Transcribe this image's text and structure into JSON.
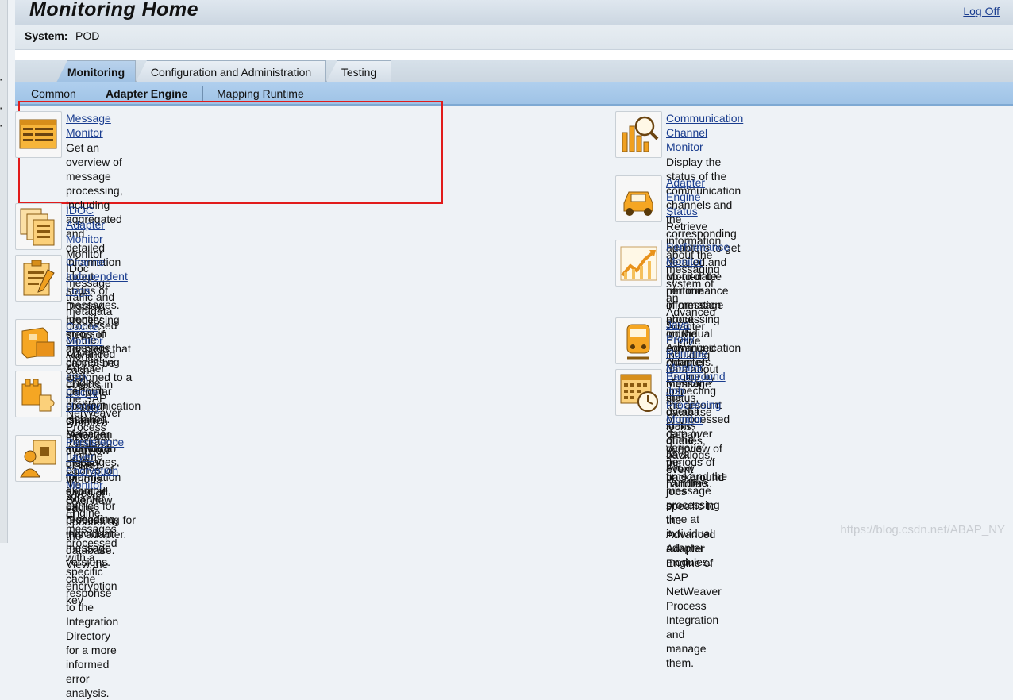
{
  "header": {
    "title": "Monitoring Home",
    "logoff_label": "Log Off"
  },
  "system": {
    "label": "System:",
    "value": "POD"
  },
  "tabs": [
    {
      "label": "Monitoring",
      "active": true
    },
    {
      "label": "Configuration and Administration",
      "active": false
    },
    {
      "label": "Testing",
      "active": false
    }
  ],
  "subnav": [
    {
      "label": "Common",
      "active": false
    },
    {
      "label": "Adapter Engine",
      "active": true
    },
    {
      "label": "Mapping Runtime",
      "active": false
    }
  ],
  "left_items": [
    {
      "title": "Message Monitor",
      "icon": "message-list-icon",
      "lines": [
        "Get an overview of message processing, including aggregated and",
        "detailed information about status of messages. Identify errors in",
        "message processing and perform problem isolation. Manage",
        "individual messages, for example, by resending individual message",
        "versions."
      ]
    },
    {
      "title": "IDOC Adapter Monitor",
      "icon": "idoc-documents-icon",
      "lines": [
        "Monitor IDoc message traffic and metadata processed on the",
        "Advanced Adapter Engine."
      ]
    },
    {
      "title": "Channel-Independent Logs",
      "icon": "clipboard-log-icon",
      "lines": [
        "Display processing steps of adapters that cannot be assigned to a",
        "particular communication channel. Select an adapter to display",
        "information about all entries for processing for this adapter."
      ]
    },
    {
      "title": "Cache Monitor",
      "icon": "cache-boxes-icon",
      "lines": [
        "Monitor cache objects in the SAP NetWeaver Process Integration",
        "runtime caches of the Adapter Engine."
      ]
    },
    {
      "title": "CPA Cache History",
      "icon": "puzzle-history-icon",
      "lines": [
        "Obtain a historical overview of the various types of cache updates to",
        "the database. View the cache response to the Integration Directory",
        "for a more informed error analysis."
      ]
    },
    {
      "title": "Persistence Layer Encryption Monitor",
      "icon": "encryption-user-icon",
      "lines": [
        "Overview of messages processed with a specific encryption key"
      ]
    }
  ],
  "right_items": [
    {
      "title": "Communication Channel Monitor",
      "icon": "channel-chart-magnifier-icon",
      "lines": [
        "Display the status of the communication channels and the",
        "corresponding adapters to get detailed and up-to-date runtime",
        "information about individual communication channels."
      ]
    },
    {
      "title": "Adapter Engine Status",
      "icon": "engine-car-icon",
      "lines": [
        "Retrieve information about the messaging system of an Advanced",
        "Adapter Engine including data about message status, database",
        "locks, queues, backlogs, event handlers."
      ]
    },
    {
      "title": "Performance Monitor",
      "icon": "performance-graph-icon",
      "lines": [
        "Monitor the performance of message processing on the Advanced",
        "Adapter Engine by inspecting the amount of processed data over",
        "various periods of time and the message processing time at",
        "individual adapter modules."
      ]
    },
    {
      "title": "Java Proxy Runtime Monitor",
      "icon": "proxy-train-icon",
      "lines": [
        "Monitor the overall status of the Java Proxy Runtime"
      ]
    },
    {
      "title": "Background Job Processing Monitor",
      "icon": "calendar-clock-icon",
      "lines": [
        "Get an overview of the background jobs specific to the Advanced",
        "Adapter Engine of SAP NetWeaver Process Integration and manage",
        "them."
      ]
    }
  ],
  "colors": {
    "link": "#1a3d8f",
    "highlight_box": "#e11b1b",
    "icon_orange": "#f0a020"
  },
  "watermark": "https://blog.csdn.net/ABAP_NY"
}
